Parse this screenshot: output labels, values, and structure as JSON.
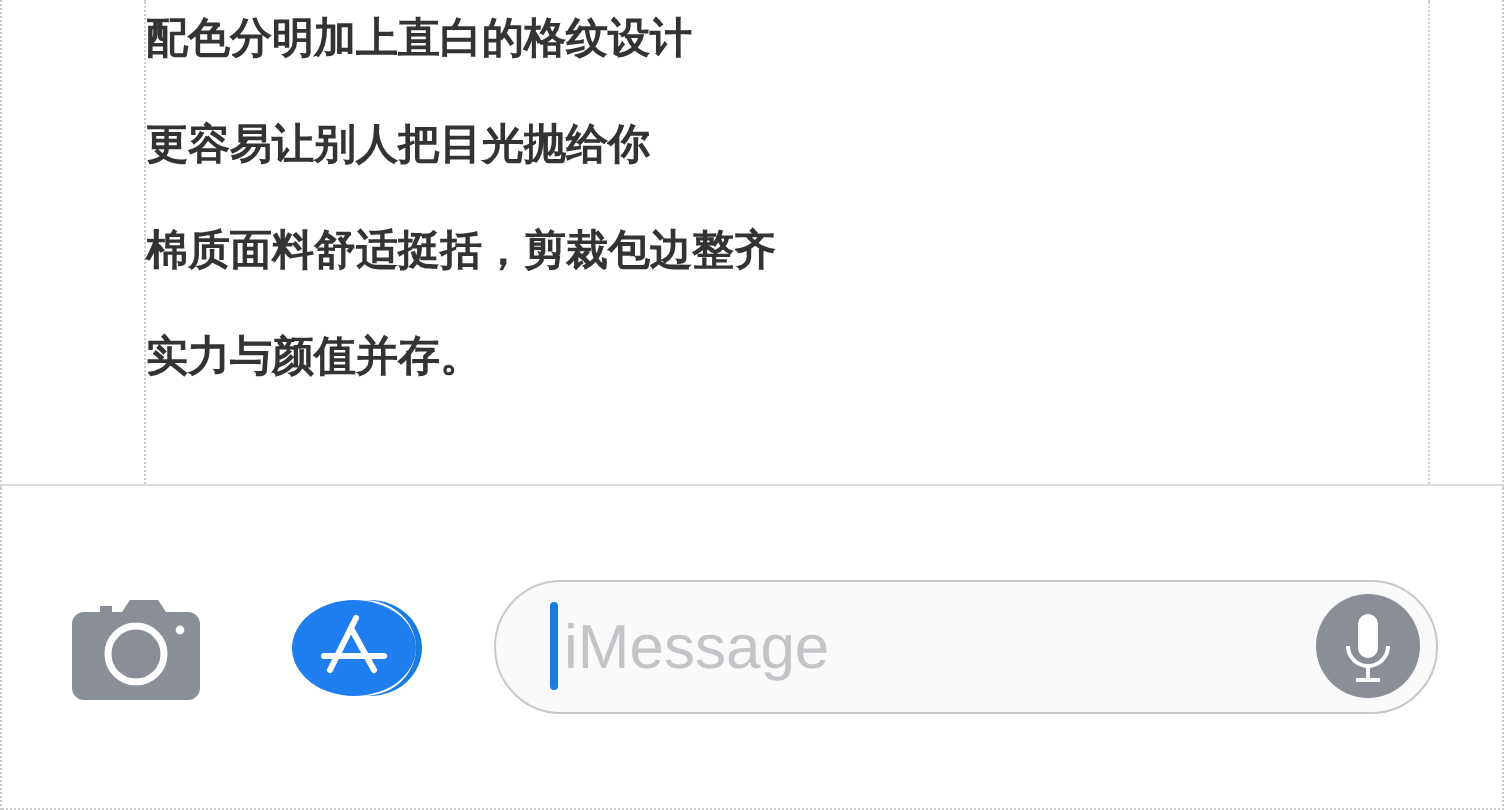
{
  "article": {
    "lines": [
      "配色分明加上直白的格纹设计",
      "更容易让别人把目光抛给你",
      "棉质面料舒适挺括，剪裁包边整齐",
      "实力与颜值并存。"
    ]
  },
  "compose_bar": {
    "message_field": {
      "placeholder": "iMessage"
    }
  }
}
